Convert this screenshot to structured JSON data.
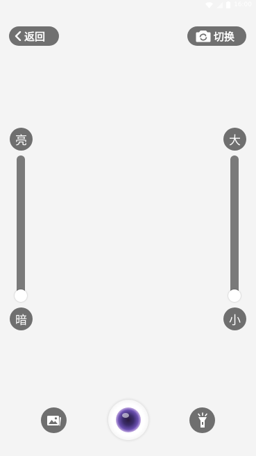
{
  "status_bar": {
    "time": "16:00"
  },
  "header": {
    "back_label": "返回",
    "switch_label": "切换"
  },
  "brightness": {
    "top_label": "亮",
    "bottom_label": "暗",
    "level": 0
  },
  "zoom": {
    "top_label": "大",
    "bottom_label": "小",
    "level": 0
  },
  "bottom_bar": {
    "left_icon": "gallery-icon",
    "center_icon": "shutter-lens-icon",
    "right_icon": "flashlight-icon"
  },
  "colors": {
    "background": "#f4f4f4",
    "button": "#707070",
    "track": "#7a7a7a"
  }
}
